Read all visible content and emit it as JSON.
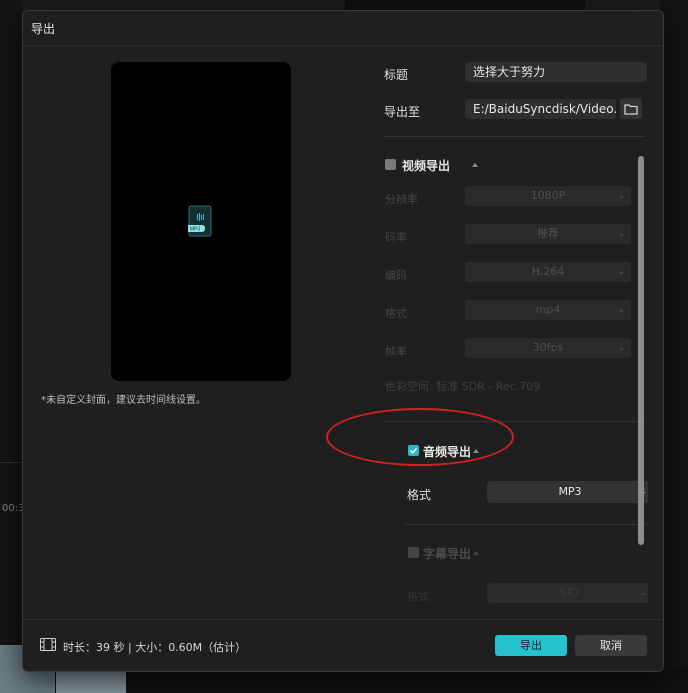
{
  "dialog": {
    "title": "导出",
    "cover_hint": "*未自定义封面，建议去时间线设置。",
    "preview": {
      "file_badge": "MP3"
    }
  },
  "fields": {
    "title_label": "标题",
    "title_value": "选择大于努力",
    "export_to_label": "导出至",
    "export_to_value": "E:/BaiduSyncdisk/Video..."
  },
  "video_export": {
    "checked": false,
    "label": "视频导出",
    "rows": [
      {
        "label": "分辨率",
        "value": "1080P"
      },
      {
        "label": "码率",
        "value": "推荐"
      },
      {
        "label": "编码",
        "value": "H.264"
      },
      {
        "label": "格式",
        "value": "mp4"
      },
      {
        "label": "帧率",
        "value": "30fps"
      }
    ],
    "color_space_label": "色彩空间:",
    "color_space_value": "标准 SDR - Rec.709"
  },
  "audio_export": {
    "checked": true,
    "label": "音频导出",
    "format_label": "格式",
    "format_value": "MP3"
  },
  "subtitle_export": {
    "checked": false,
    "label": "字幕导出",
    "partial_label": "格式",
    "partial_value": "SRT"
  },
  "footer": {
    "info": "时长：39 秒 | 大小：0.60M（估计）",
    "export_button": "导出",
    "cancel_button": "取消"
  },
  "background": {
    "timecode": "00:3"
  },
  "colors": {
    "accent": "#27c2cf",
    "annotation": "#d42020",
    "dialog_bg": "#1f1f1f"
  }
}
